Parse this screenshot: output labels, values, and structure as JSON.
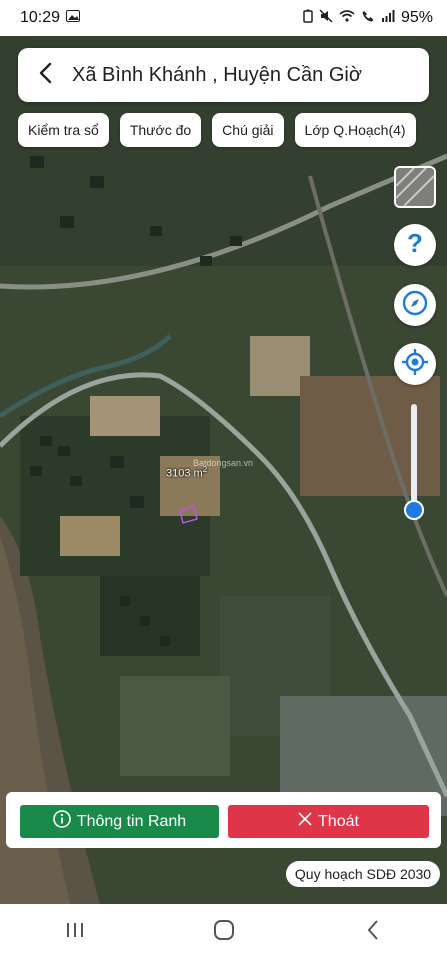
{
  "status": {
    "time": "10:29",
    "battery": "95%"
  },
  "header": {
    "title": "Xã Bình Khánh , Huyện Cần Giờ"
  },
  "chips": [
    "Kiểm tra sổ",
    "Thước đo",
    "Chú giải",
    "Lớp Q.Hoạch(4)"
  ],
  "map": {
    "area_value": "3103 m",
    "area_unit_sup": "2",
    "watermark": "Batdongsan.vn"
  },
  "actions": {
    "info_label": "Thông tin Ranh",
    "exit_label": "Thoát"
  },
  "plan_badge": "Quy hoạch SDĐ 2030",
  "colors": {
    "info": "#1a8a4a",
    "exit": "#df3548",
    "accent": "#1f7ae0"
  },
  "icons": [
    "back-arrow-icon",
    "help-icon",
    "compass-icon",
    "locate-icon",
    "info-icon",
    "close-icon"
  ]
}
